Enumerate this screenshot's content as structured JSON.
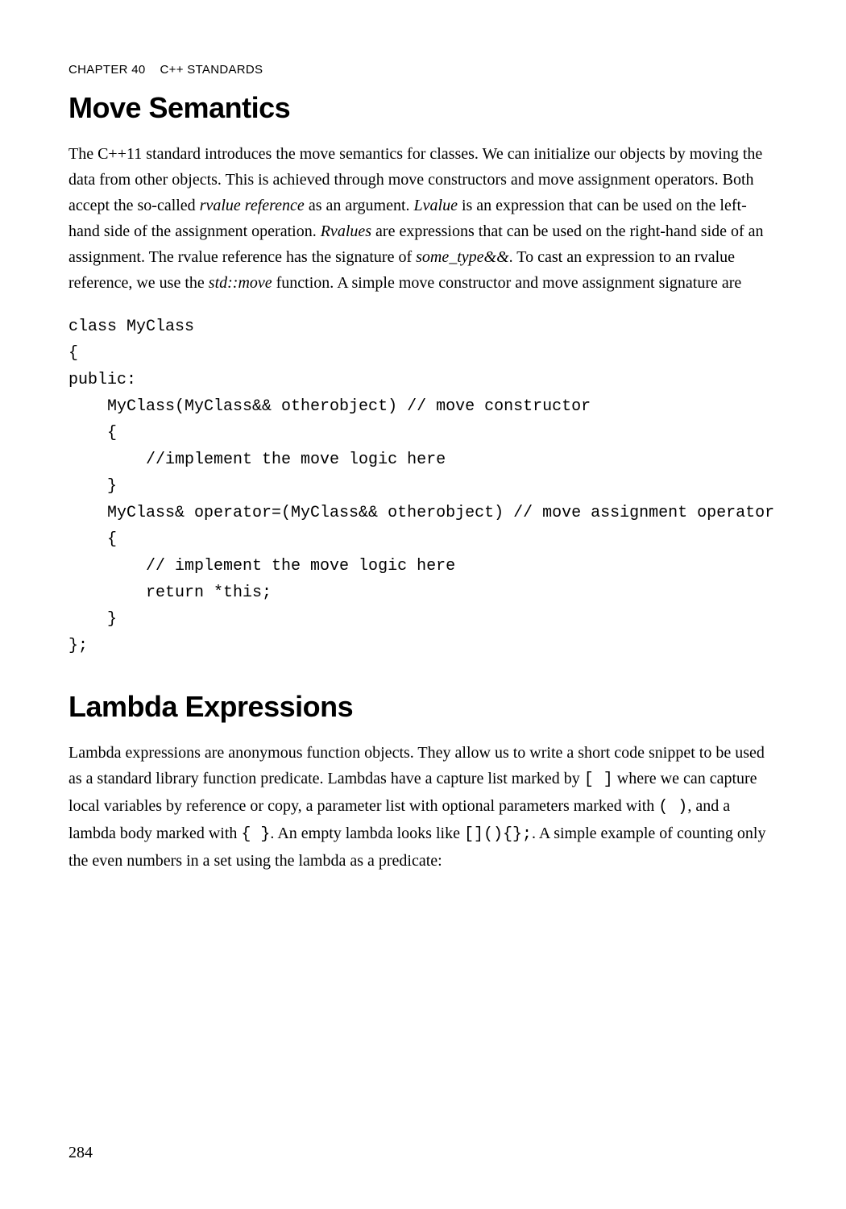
{
  "header": {
    "chapter_label": "CHAPTER 40",
    "chapter_title": "C++ STANDARDS"
  },
  "section1": {
    "heading": "Move Semantics",
    "para": {
      "t1": "The C++11 standard introduces the move semantics for classes. We can initialize our objects by moving the data from other objects. This is achieved through move constructors and move assignment operators. Both accept the so-called ",
      "i1": "rvalue reference",
      "t2": " as an argument. ",
      "i2": "Lvalue",
      "t3": " is an expression that can be used on the left-hand side of the assignment operation. ",
      "i3": "Rvalues",
      "t4": " are expressions that can be used on the right-hand side of an assignment. The rvalue reference has the signature of ",
      "i4": "some_type&&",
      "t5": ". To cast an expression to an rvalue reference, we use the ",
      "i5": "std::move",
      "t6": " function. A simple move constructor and move assignment signature are"
    },
    "code": "class MyClass\n{\npublic:\n    MyClass(MyClass&& otherobject) // move constructor\n    {\n        //implement the move logic here\n    }\n    MyClass& operator=(MyClass&& otherobject) // move assignment operator\n    {\n        // implement the move logic here\n        return *this;\n    }\n};"
  },
  "section2": {
    "heading": "Lambda Expressions",
    "para": {
      "t1": "Lambda expressions are anonymous function objects. They allow us to write a short code snippet to be used as a standard library function predicate. Lambdas have a capture list marked by ",
      "m1": "[ ]",
      "t2": " where we can capture local variables by reference or copy, a parameter list with optional parameters marked with ",
      "m2": "( )",
      "t3": ", and a lambda body marked with ",
      "m3": "{ }",
      "t4": ". An empty lambda looks like ",
      "m4": "[](){};",
      "t5": ". A simple example of counting only the even numbers in a set using the lambda as a predicate:"
    }
  },
  "page_number": "284"
}
